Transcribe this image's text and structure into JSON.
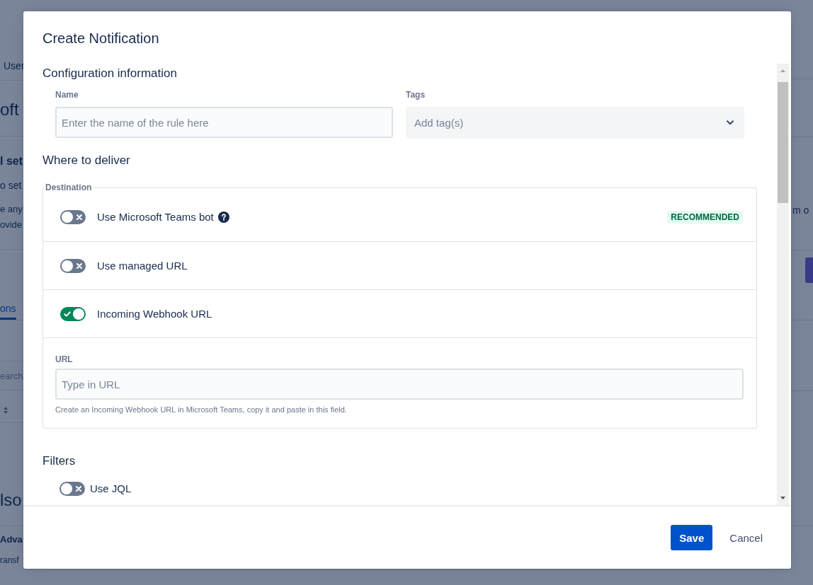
{
  "background_page": {
    "breadcrumb": "User",
    "title": "oft",
    "setup": {
      "heading": "l set",
      "lines": [
        "o set",
        "e any",
        "ovide"
      ],
      "line_end": "m o"
    },
    "tab": {
      "label": "ons",
      "selected": true
    },
    "search": {
      "placeholder": "earch"
    },
    "also": {
      "heading": "lso",
      "card_title": "Adva",
      "card_text": "ransf"
    }
  },
  "dialog": {
    "title": "Create Notification",
    "configuration": {
      "heading": "Configuration information",
      "name_field": {
        "label": "Name",
        "placeholder": "Enter the name of the rule here"
      },
      "tags_field": {
        "label": "Tags",
        "placeholder": "Add tag(s)"
      }
    },
    "delivery": {
      "heading": "Where to deliver",
      "legend": "Destination",
      "options": [
        {
          "label": "Use Microsoft Teams bot",
          "on": false,
          "help_icon": true,
          "badge": "RECOMMENDED"
        },
        {
          "label": "Use managed URL",
          "on": false
        },
        {
          "label": "Incoming Webhook URL",
          "on": true
        }
      ],
      "url_field": {
        "label": "URL",
        "placeholder": "Type in URL",
        "hint": "Create an Incoming Webhook URL in Microsoft Teams, copy it and paste in this field."
      }
    },
    "filters": {
      "heading": "Filters",
      "options": [
        {
          "label": "Use JQL",
          "on": false
        }
      ]
    },
    "buttons": [
      {
        "label": "Save",
        "kind": "primary"
      },
      {
        "label": "Cancel",
        "kind": "subtle"
      }
    ]
  }
}
